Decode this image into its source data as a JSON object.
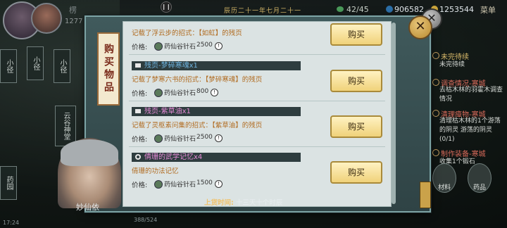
{
  "hud": {
    "player_name": "楞",
    "player_stat": "1277",
    "pause_icon": "pause-icon",
    "date_text": "辰历二十一年七月二十一",
    "stamina": "42/45",
    "silver": "906582",
    "gold": "1253544",
    "menu_label": "菜单"
  },
  "map_nodes": [
    "小径",
    "小径",
    "小径",
    "小径",
    "云谷神堂",
    "药园"
  ],
  "dialog": {
    "tab_label": "购买物品",
    "close_icon": "close-icon",
    "items": [
      {
        "name": "",
        "desc": "记载了浮云步的招式：【如虹】的残页",
        "price_label": "价格:",
        "currency": "药仙谷针石",
        "cost": "2500",
        "buy_label": "购买"
      },
      {
        "name": "残页-梦碎寒魂x1",
        "desc": "记载了梦寒六书的招式：【梦碎寒魂】的残页",
        "price_label": "价格:",
        "currency": "药仙谷针石",
        "cost": "800",
        "buy_label": "购买"
      },
      {
        "name": "残页-紫草油x1",
        "desc": "记载了灵枢素问集的招式：【紫草油】的残页",
        "price_label": "价格:",
        "currency": "药仙谷针石",
        "cost": "2500",
        "buy_label": "购买"
      },
      {
        "name": "倩珊的武学记忆x4",
        "desc": "倩珊的功法记忆",
        "price_label": "价格:",
        "currency": "药仙谷针石",
        "cost": "1500",
        "buy_label": "购买"
      }
    ],
    "footer_label": "上货时间:",
    "footer_text": "十三天十个时辰"
  },
  "npc_name": "妙仙依",
  "quests": [
    {
      "title": "未完待续",
      "body": "未完待续"
    },
    {
      "title": "调查情况-寒城",
      "body": "去枯木林的羽霍木调查情况"
    },
    {
      "title": "清理瘴物-寒城",
      "body": "清理枯木林的1个游荡的阴灵 游荡的阴灵(0/1)"
    },
    {
      "title": "制作装备-寒城",
      "body": "收集1个锻石"
    }
  ],
  "right_icons": [
    "材料",
    "药品"
  ],
  "bottom": {
    "hp_text": "388/524",
    "time_text": "17:24"
  },
  "colors": {
    "dialog_bg": "#405a5c",
    "buy_button": "#f0d27a",
    "item_name": "#6fb5e0",
    "item_desc": "#b06a1e",
    "footer_label": "#f0c26a"
  }
}
